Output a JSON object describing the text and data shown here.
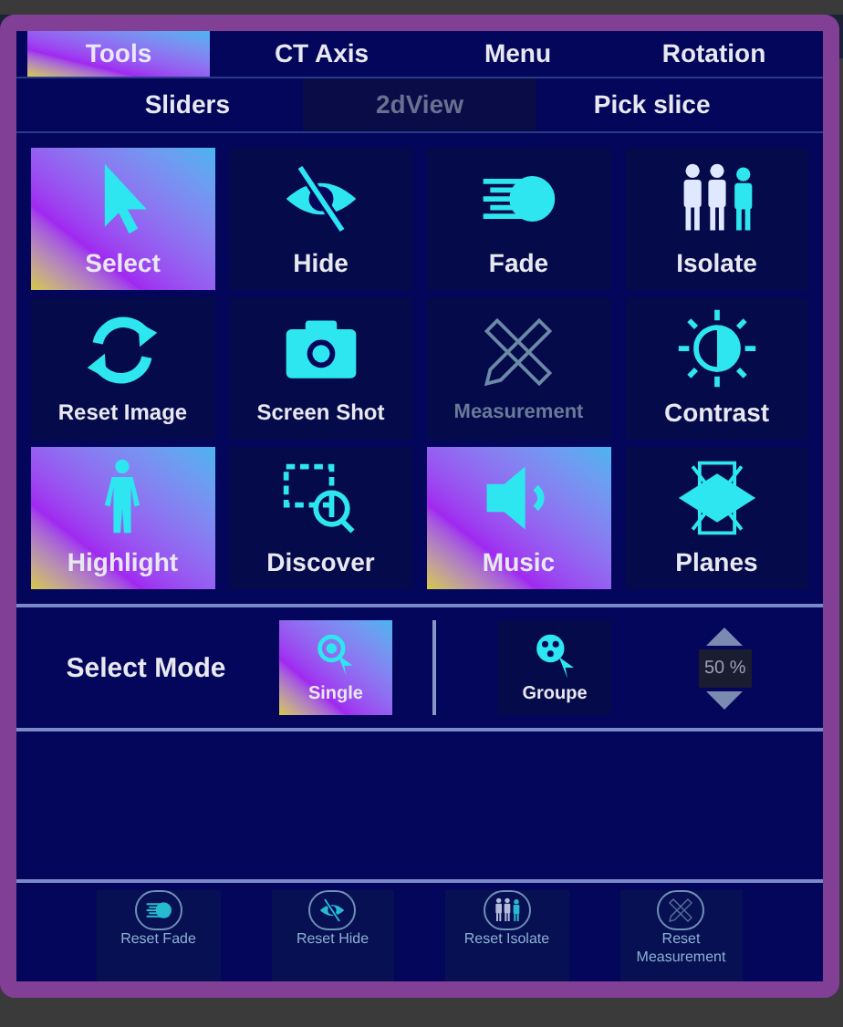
{
  "tabs": [
    {
      "label": "Tools",
      "selected": true
    },
    {
      "label": "CT Axis",
      "selected": false
    },
    {
      "label": "Menu",
      "selected": false
    },
    {
      "label": "Rotation",
      "selected": false
    }
  ],
  "subtabs": [
    {
      "label": "Sliders",
      "disabled": false
    },
    {
      "label": "2dView",
      "disabled": true
    },
    {
      "label": "Pick slice",
      "disabled": false
    }
  ],
  "tools": [
    {
      "kind": "cursor",
      "label": "Select",
      "active": true,
      "disabled": false
    },
    {
      "kind": "eye-slash",
      "label": "Hide",
      "active": false,
      "disabled": false
    },
    {
      "kind": "fade",
      "label": "Fade",
      "active": false,
      "disabled": false
    },
    {
      "kind": "people",
      "label": "Isolate",
      "active": false,
      "disabled": false
    },
    {
      "kind": "refresh",
      "label": "Reset Image",
      "active": false,
      "disabled": false
    },
    {
      "kind": "camera",
      "label": "Screen Shot",
      "active": false,
      "disabled": false
    },
    {
      "kind": "ruler",
      "label": "Measurement",
      "active": false,
      "disabled": true
    },
    {
      "kind": "contrast",
      "label": "Contrast",
      "active": false,
      "disabled": false
    },
    {
      "kind": "body",
      "label": "Highlight",
      "active": true,
      "disabled": false
    },
    {
      "kind": "discover",
      "label": "Discover",
      "active": false,
      "disabled": false
    },
    {
      "kind": "speaker",
      "label": "Music",
      "active": true,
      "disabled": false
    },
    {
      "kind": "planes",
      "label": "Planes",
      "active": false,
      "disabled": false
    }
  ],
  "select_mode": {
    "label": "Select Mode",
    "options": [
      {
        "kind": "single",
        "label": "Single",
        "selected": true
      },
      {
        "kind": "group",
        "label": "Groupe",
        "selected": false
      }
    ],
    "stepper_value": "50 %"
  },
  "reset_buttons": [
    {
      "kind": "fade",
      "label": "Reset Fade"
    },
    {
      "kind": "eye-slash",
      "label": "Reset Hide"
    },
    {
      "kind": "people",
      "label": "Reset Isolate"
    },
    {
      "kind": "ruler",
      "label": "Reset Measurement"
    }
  ]
}
